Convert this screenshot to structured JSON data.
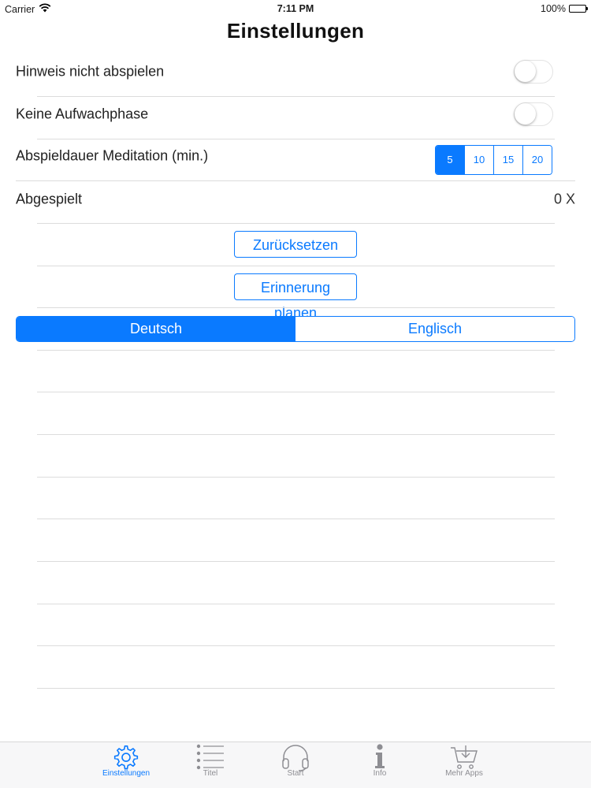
{
  "status_bar": {
    "carrier": "Carrier",
    "time": "7:11 PM",
    "battery": "100%",
    "battery_level": 1.0
  },
  "page": {
    "title": "Einstellungen"
  },
  "settings": {
    "hint_label": "Hinweis nicht abspielen",
    "hint_toggle_on": false,
    "wake_label": "Keine Aufwachphase",
    "wake_toggle_on": false,
    "duration_label": "Abspieldauer Meditation (min.)",
    "duration_options": [
      "5",
      "10",
      "15",
      "20"
    ],
    "duration_selected": "5",
    "played_label": "Abgespielt",
    "played_value": "0 X"
  },
  "buttons": {
    "reset_label": "Zurücksetzen",
    "reminder_label": "Erinnerung planen"
  },
  "language": {
    "options": [
      "Deutsch",
      "Englisch"
    ],
    "selected": "Deutsch"
  },
  "tab_bar": {
    "items": [
      {
        "label": "Einstellungen",
        "icon": "gear-icon",
        "active": true
      },
      {
        "label": "Titel",
        "icon": "list-icon",
        "active": false
      },
      {
        "label": "Start",
        "icon": "headphones-icon",
        "active": false
      },
      {
        "label": "Info",
        "icon": "info-icon",
        "active": false
      },
      {
        "label": "Mehr Apps",
        "icon": "cart-icon",
        "active": false
      }
    ]
  },
  "colors": {
    "accent": "#0a7aff",
    "inactive_tab": "#8e8e93"
  }
}
